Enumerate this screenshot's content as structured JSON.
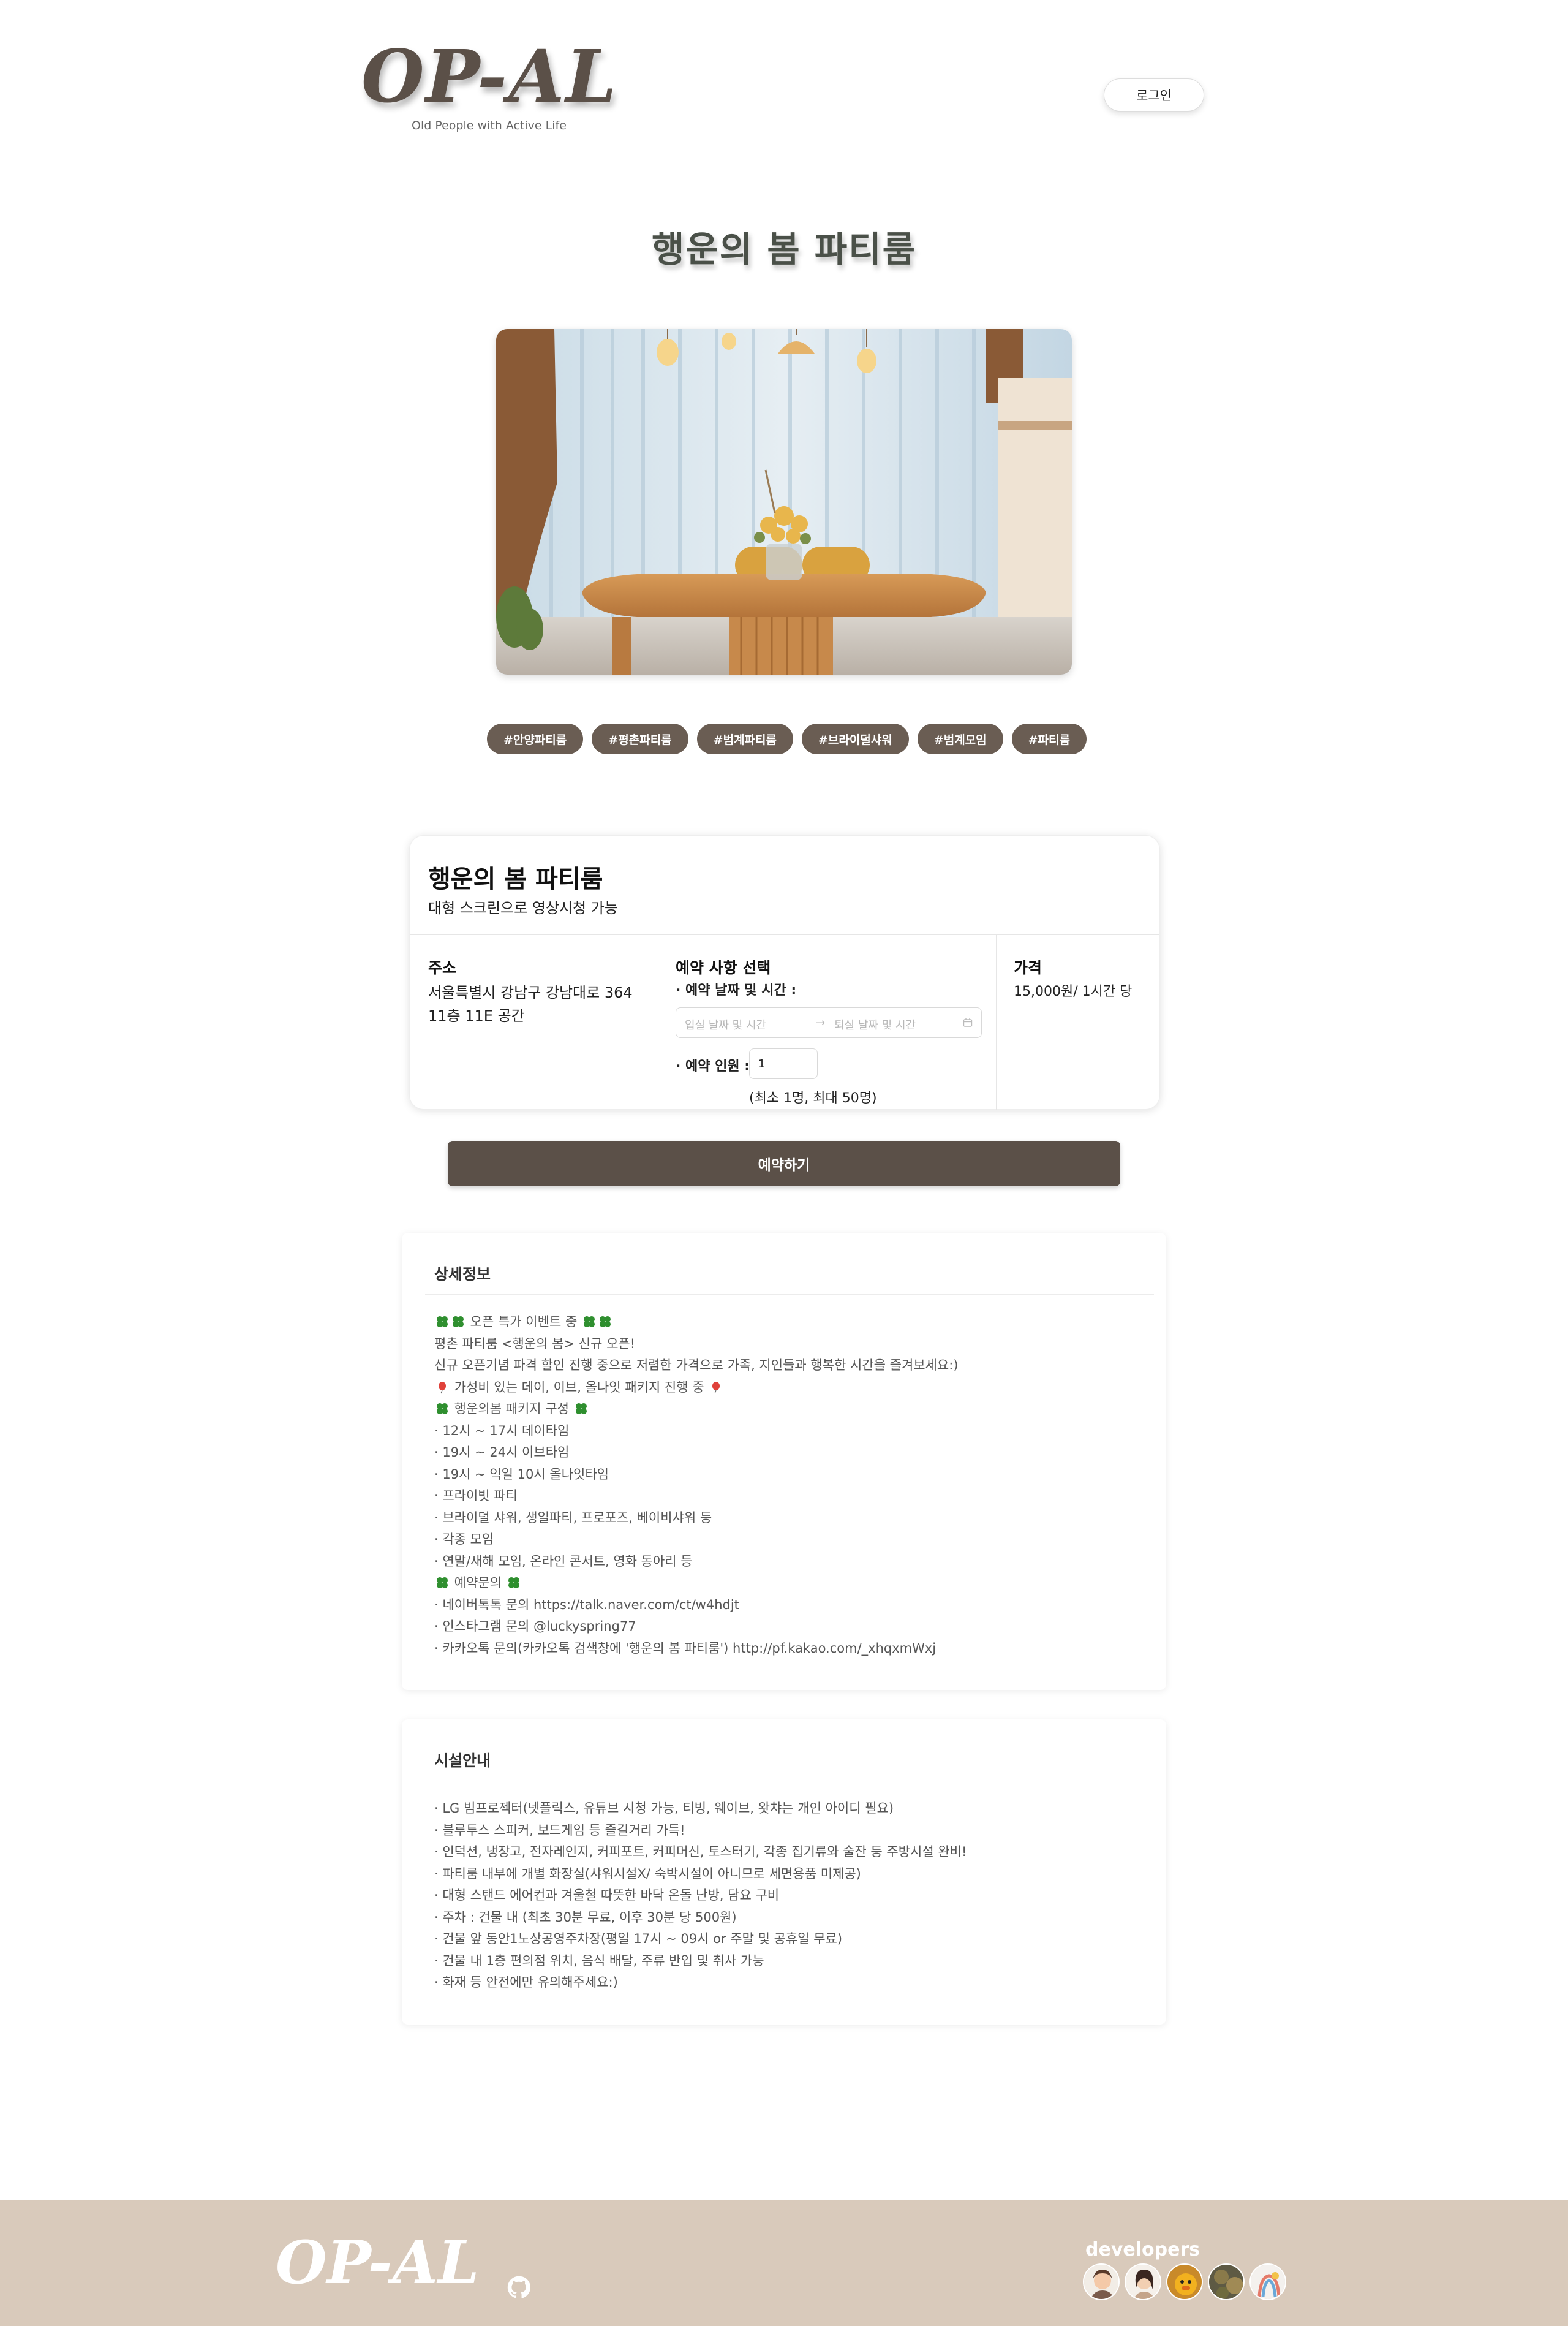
{
  "header": {
    "logo": "OP-AL",
    "tagline": "Old People with Active Life",
    "login_label": "로그인"
  },
  "page": {
    "title": "행운의 봄 파티룸"
  },
  "hero_image": {
    "icon": "party-room-photo"
  },
  "tags": [
    "#안양파티룸",
    "#평촌파티룸",
    "#범계파티룸",
    "#브라이덜샤워",
    "#범계모임",
    "#파티룸"
  ],
  "booking": {
    "name": "행운의 봄 파티룸",
    "subtitle": "대형 스크린으로 영상시청 가능",
    "address_label": "주소",
    "address_line1": "서울특별시 강남구 강남대로 364",
    "address_line2": "11층 11E 공간",
    "reserve_label": "예약 사항 선택",
    "date_label": "· 예약 날짜 및 시간 :",
    "checkin_placeholder": "입실 날짜 및 시간",
    "checkout_placeholder": "퇴실 날짜 및 시간",
    "arrow": "→",
    "people_label": "· 예약 인원 :",
    "people_value": "1",
    "people_range": "(최소 1명, 최대 50명)",
    "price_label": "가격",
    "price_value": "15,000원/ 1시간 당"
  },
  "book_button": "예약하기",
  "detail": {
    "title": "상세정보",
    "lines": [
      " 오픈 특가 이벤트 중 ",
      "평촌 파티룸 <행운의 봄> 신규 오픈!",
      "신규 오픈기념 파격 할인 진행 중으로 저렴한 가격으로 가족, 지인들과 행복한 시간을 즐겨보세요:)",
      " 가성비 있는 데이, 이브, 올나잇 패키지 진행 중 ",
      " 행운의봄 패키지 구성 ",
      "· 12시 ~ 17시 데이타임",
      "· 19시 ~ 24시 이브타임",
      "· 19시 ~ 익일 10시 올나잇타임",
      "· 프라이빗 파티",
      "· 브라이덜 샤워, 생일파티, 프로포즈, 베이비샤워 등",
      "· 각종 모임",
      "· 연말/새해 모임, 온라인 콘서트, 영화 동아리 등",
      " 예약문의 ",
      "· 네이버톡톡 문의 https://talk.naver.com/ct/w4hdjt",
      "· 인스타그램 문의 @luckyspring77",
      "· 카카오톡 문의(카카오톡 검색창에 '행운의 봄 파티룸') http://pf.kakao.com/_xhqxmWxj"
    ]
  },
  "facility": {
    "title": "시설안내",
    "lines": [
      "· LG 빔프로젝터(넷플릭스, 유튜브 시청 가능, 티빙, 웨이브, 왓챠는 개인 아이디 필요)",
      "· 블루투스 스피커, 보드게임 등 즐길거리 가득!",
      "· 인덕션, 냉장고, 전자레인지, 커피포트, 커피머신, 토스터기, 각종 집기류와 술잔 등 주방시설 완비!",
      "· 파티룸 내부에 개별 화장실(샤워시설X/ 숙박시설이 아니므로 세면용품 미제공)",
      "· 대형 스탠드 에어컨과 겨울철 따뜻한 바닥 온돌 난방, 담요 구비",
      "· 주차 : 건물 내 (최초 30분 무료, 이후 30분 당 500원)",
      "· 건물 앞 동안1노상공영주차장(평일 17시 ~ 09시 or 주말 및 공휴일 무료)",
      "· 건물 내 1층 편의점 위치, 음식 배달, 주류 반입 및 취사 가능",
      "· 화재 등 안전에만 유의해주세요:)"
    ]
  },
  "footer": {
    "logo": "OP-AL",
    "github_icon": "github-icon",
    "developers_label": "developers"
  }
}
